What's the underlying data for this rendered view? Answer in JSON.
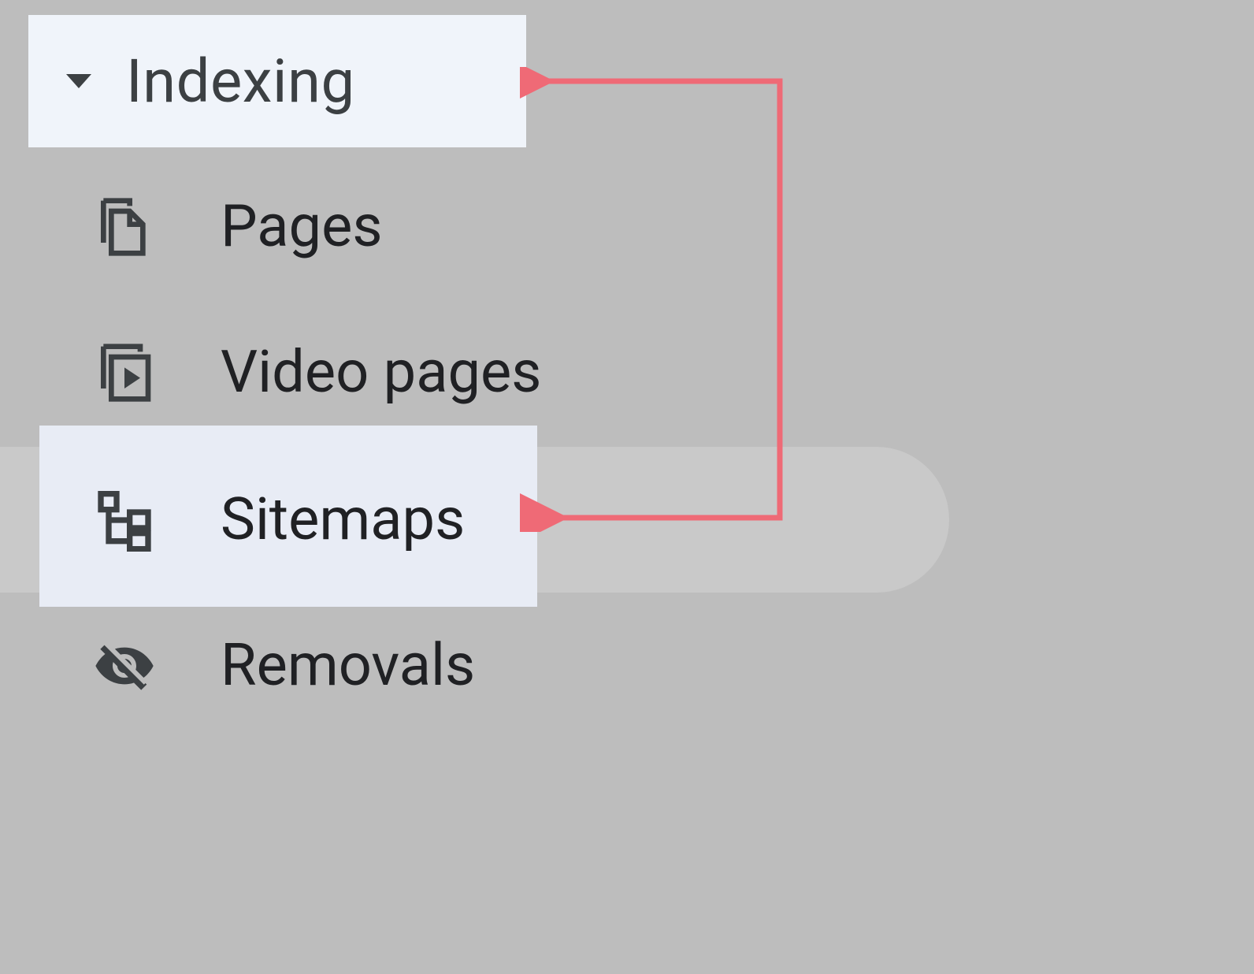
{
  "sidebar": {
    "section": {
      "title": "Indexing"
    },
    "items": [
      {
        "label": "Pages"
      },
      {
        "label": "Video pages"
      },
      {
        "label": "Sitemaps"
      },
      {
        "label": "Removals"
      }
    ]
  },
  "colors": {
    "annotation": "#ef6a76"
  }
}
